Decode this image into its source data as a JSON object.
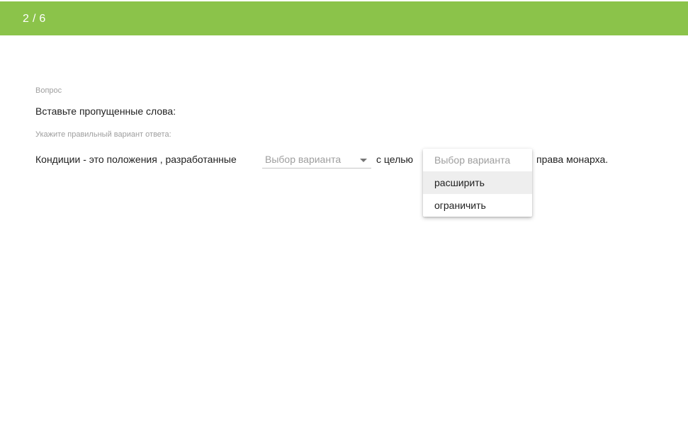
{
  "header": {
    "progress": "2 / 6",
    "bar_color": "#8bc34a"
  },
  "question": {
    "label": "Вопрос",
    "text": "Вставьте пропущенные слова:",
    "hint": "Укажите правильный вариант ответа:"
  },
  "sentence": {
    "part_1": "Кондиции - это положения , разработанные",
    "part_2": "с целью",
    "part_3": "права монарха."
  },
  "select_1": {
    "value": "Выбор варианта",
    "icon": "chevron-down-icon"
  },
  "dropdown": {
    "placeholder": "Выбор варианта",
    "options": [
      "расширить",
      "ограничить"
    ],
    "highlighted_index": 0
  }
}
